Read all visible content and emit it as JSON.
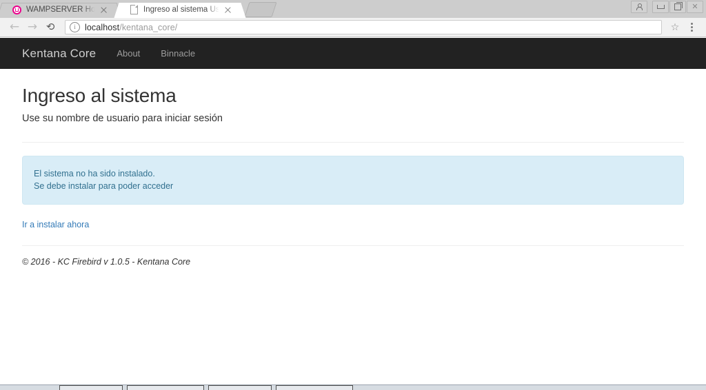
{
  "browser": {
    "tabs": [
      {
        "title": "WAMPSERVER Homepage",
        "favicon": "wamp-logo-icon",
        "active": false,
        "close_label": "×"
      },
      {
        "title": "Ingreso al sistema Use su",
        "favicon": "document-icon",
        "active": true,
        "close_label": "×"
      }
    ],
    "new_tab_label": "",
    "window_controls": [
      "person-icon",
      "minimize-icon",
      "restore-icon",
      "close-icon"
    ],
    "toolbar": {
      "back_glyph": "←",
      "forward_glyph": "→",
      "reload_glyph": "⟳",
      "site_info_glyph": "i",
      "url_host": "localhost",
      "url_path": "/kentana_core/",
      "bookmark_glyph": "☆",
      "menu_glyph": "⋮"
    }
  },
  "page": {
    "navbar": {
      "brand": "Kentana Core",
      "links": [
        {
          "label": "About"
        },
        {
          "label": "Binnacle"
        }
      ]
    },
    "title": "Ingreso al sistema",
    "subtitle": "Use su nombre de usuario para iniciar sesión",
    "alert": {
      "line1": "El sistema no ha sido instalado.",
      "line2": "Se debe instalar para poder acceder",
      "background_color": "#d9edf7",
      "text_color": "#31708f"
    },
    "install_link": "Ir a instalar ahora",
    "footer": "© 2016 - KC Firebird v 1.0.5 - Kentana Core",
    "link_color": "#337ab7"
  },
  "taskbar": {
    "items": [
      "window-button-1",
      "window-button-2",
      "window-button-3",
      "window-button-4"
    ]
  }
}
